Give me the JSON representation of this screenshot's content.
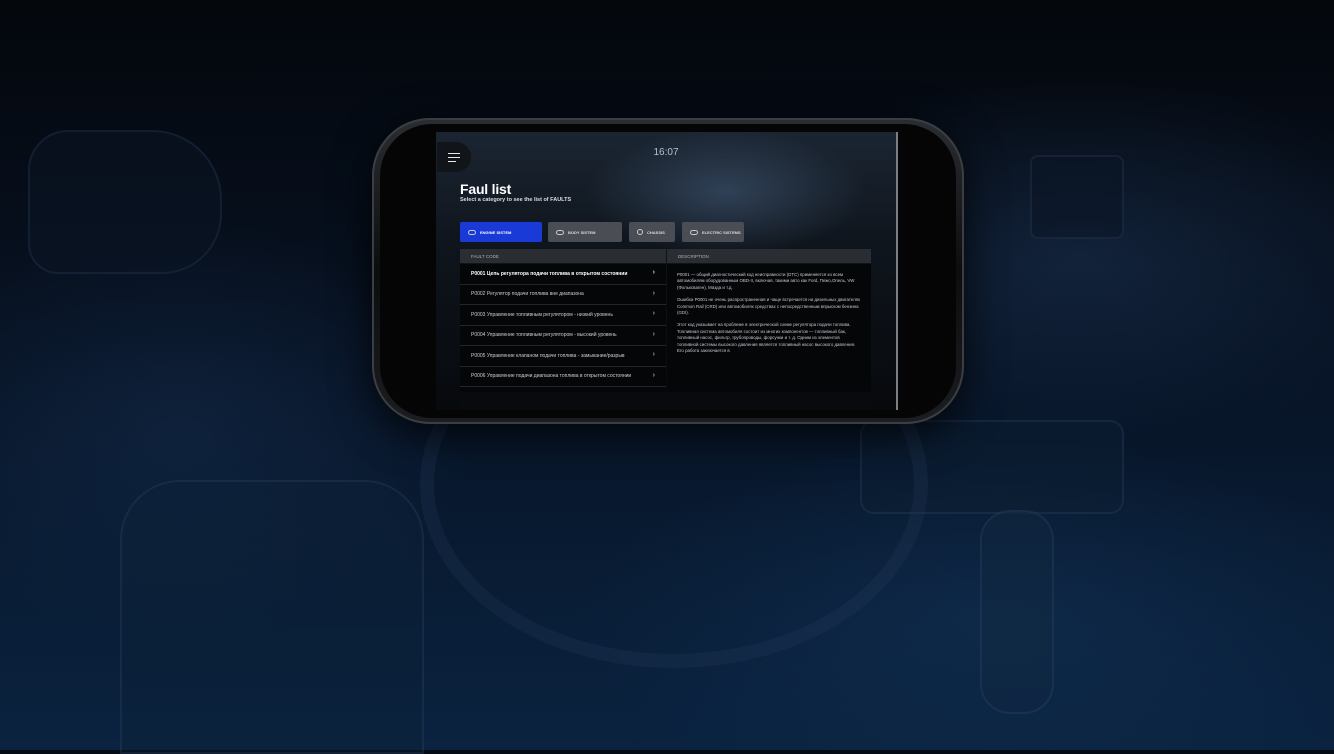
{
  "status_bar": {
    "time": "16:07"
  },
  "header": {
    "title": "Faul list",
    "subtitle": "Select a category to see the list of FAULTS"
  },
  "tabs": [
    {
      "label": "ENGINE SISTEM",
      "icon": "engine-icon",
      "active": true
    },
    {
      "label": "BODY SISTEM",
      "icon": "car-body-icon",
      "active": false
    },
    {
      "label": "CHASSIS",
      "icon": "chassis-icon",
      "active": false
    },
    {
      "label": "ELECTRIC SISTEMS",
      "icon": "electric-icon",
      "active": false
    }
  ],
  "table": {
    "columns": {
      "code": "FAULT CODE",
      "description": "DESCRIPTION"
    },
    "rows": [
      {
        "text": "P0001 Цепь регулятора подачи топлива в открытом состоянии"
      },
      {
        "text": "P0002 Регулятор подачи топлива вне диапазона"
      },
      {
        "text": "P0003 Управление топливным регулятором - низкий уровень"
      },
      {
        "text": "P0004 Управление топливным регулятором - высокий уровень"
      },
      {
        "text": "P0005 Управление клапаном подачи топлива - замыкание/разрыв"
      },
      {
        "text": "P0006 Управление подачи диапазона топлива в открытом состоянии"
      }
    ],
    "description": [
      "P0001 — общий диагностический код неисправности (DTC) применяется ко всем автомобилям оборудованным OBD-II, включая, такими авто как Ford, Пежо,Опель, VW (Фольксваген), Мазда и т.д.",
      "Ошибка P0001 не очень распространенная и чаще встречается на дизельных двигателях Common Rail (CRD) или автомобилях средствах с непосредственным впрыском бензина (GDI).",
      "Этот код указывает на проблеме в электрической схеме регулятора подачи топлива. Топливная система автомобиля состоит из многих компонентов — топливный бак, топливный насос, фильтр, трубопроводы, форсунки и т. д. Одним из элементов топливной системы высокого давления является топливный насос высокого давления. Его работа заключается в"
    ]
  },
  "colors": {
    "accent": "#1a3ad8",
    "tab_inactive": "#4a4d54",
    "background": "#071223"
  }
}
